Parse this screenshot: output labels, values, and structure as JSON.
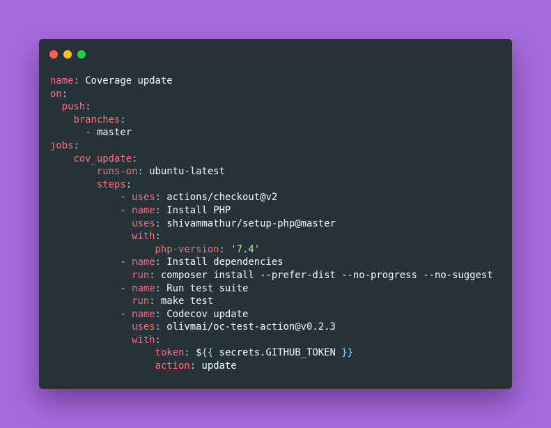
{
  "colors": {
    "background": "#a66bdb",
    "window": "#263238",
    "key": "#f07178",
    "string": "#c3e88d",
    "punctuation": "#89ddff",
    "text": "#eeffff"
  },
  "window_controls": [
    {
      "name": "close",
      "color": "#ff5f56"
    },
    {
      "name": "minimize",
      "color": "#ffbd2e"
    },
    {
      "name": "maximize",
      "color": "#27c93f"
    }
  ],
  "code": {
    "line_1": {
      "key": "name",
      "value": "Coverage update"
    },
    "line_2": {
      "key": "on"
    },
    "line_3": {
      "key": "push"
    },
    "line_4": {
      "key": "branches"
    },
    "line_5": {
      "dash": "-",
      "value": "master"
    },
    "line_6": {
      "key": "jobs"
    },
    "line_7": {
      "key": "cov_update"
    },
    "line_8": {
      "key": "runs-on",
      "value": "ubuntu-latest"
    },
    "line_9": {
      "key": "steps"
    },
    "line_10": {
      "dash": "-",
      "key": "uses",
      "value": "actions/checkout@v2"
    },
    "line_11": {
      "dash": "-",
      "key": "name",
      "value": "Install PHP"
    },
    "line_12": {
      "key": "uses",
      "value": "shivammathur/setup-php@master"
    },
    "line_13": {
      "key": "with"
    },
    "line_14": {
      "key": "php-version",
      "value": "'7.4'"
    },
    "line_15": {
      "dash": "-",
      "key": "name",
      "value": "Install dependencies"
    },
    "line_16": {
      "key": "run",
      "value": "composer install --prefer-dist --no-progress --no-suggest"
    },
    "line_17": {
      "dash": "-",
      "key": "name",
      "value": "Run test suite"
    },
    "line_18": {
      "key": "run",
      "value": "make test"
    },
    "line_19": {
      "dash": "-",
      "key": "name",
      "value": "Codecov update"
    },
    "line_20": {
      "key": "uses",
      "value": "olivmai/oc-test-action@v0.2.3"
    },
    "line_21": {
      "key": "with"
    },
    "line_22": {
      "key": "token",
      "value_prefix": "$",
      "value_open": "{{",
      "value_inner": " secrets.GITHUB_TOKEN ",
      "value_close": "}}"
    },
    "line_23": {
      "key": "action",
      "value": "update"
    }
  }
}
